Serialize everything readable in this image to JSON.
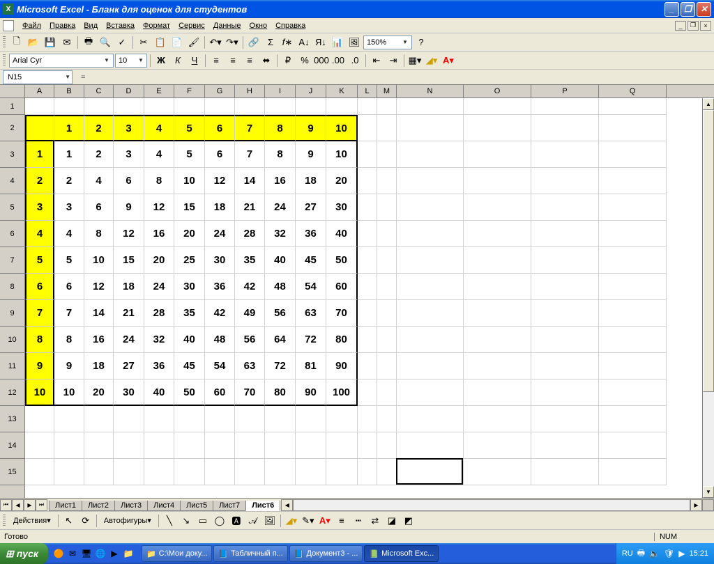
{
  "titlebar": {
    "app": "Microsoft Excel",
    "doc": "Бланк для оценок для студентов"
  },
  "menu": {
    "file": "Файл",
    "edit": "Правка",
    "view": "Вид",
    "insert": "Вставка",
    "format": "Формат",
    "tools": "Сервис",
    "data": "Данные",
    "window": "Окно",
    "help": "Справка"
  },
  "toolbar": {
    "zoom": "150%"
  },
  "format_bar": {
    "font": "Arial Cyr",
    "size": "10",
    "bold": "Ж",
    "italic": "К",
    "underline": "Ч"
  },
  "formula": {
    "namebox": "N15",
    "value": ""
  },
  "columns": [
    "A",
    "B",
    "C",
    "D",
    "E",
    "F",
    "G",
    "H",
    "I",
    "J",
    "K",
    "L",
    "M",
    "N",
    "O",
    "P",
    "Q"
  ],
  "col_widths": [
    "cw-A",
    "cw-B",
    "cw-C",
    "cw-D",
    "cw-E",
    "cw-F",
    "cw-G",
    "cw-H",
    "cw-I",
    "cw-J",
    "cw-K",
    "cw-L",
    "cw-M",
    "cw-N",
    "cw-O",
    "cw-P",
    "cw-Q"
  ],
  "rows": [
    "1",
    "2",
    "3",
    "4",
    "5",
    "6",
    "7",
    "8",
    "9",
    "10",
    "11",
    "12",
    "13",
    "14",
    "15"
  ],
  "table": {
    "header_row": [
      "",
      "1",
      "2",
      "3",
      "4",
      "5",
      "6",
      "7",
      "8",
      "9",
      "10"
    ],
    "body": [
      [
        "1",
        "1",
        "2",
        "3",
        "4",
        "5",
        "6",
        "7",
        "8",
        "9",
        "10"
      ],
      [
        "2",
        "2",
        "4",
        "6",
        "8",
        "10",
        "12",
        "14",
        "16",
        "18",
        "20"
      ],
      [
        "3",
        "3",
        "6",
        "9",
        "12",
        "15",
        "18",
        "21",
        "24",
        "27",
        "30"
      ],
      [
        "4",
        "4",
        "8",
        "12",
        "16",
        "20",
        "24",
        "28",
        "32",
        "36",
        "40"
      ],
      [
        "5",
        "5",
        "10",
        "15",
        "20",
        "25",
        "30",
        "35",
        "40",
        "45",
        "50"
      ],
      [
        "6",
        "6",
        "12",
        "18",
        "24",
        "30",
        "36",
        "42",
        "48",
        "54",
        "60"
      ],
      [
        "7",
        "7",
        "14",
        "21",
        "28",
        "35",
        "42",
        "49",
        "56",
        "63",
        "70"
      ],
      [
        "8",
        "8",
        "16",
        "24",
        "32",
        "40",
        "48",
        "56",
        "64",
        "72",
        "80"
      ],
      [
        "9",
        "9",
        "18",
        "27",
        "36",
        "45",
        "54",
        "63",
        "72",
        "81",
        "90"
      ],
      [
        "10",
        "10",
        "20",
        "30",
        "40",
        "50",
        "60",
        "70",
        "80",
        "90",
        "100"
      ]
    ]
  },
  "selection": {
    "cell": "N15"
  },
  "sheets": {
    "tabs": [
      "Лист1",
      "Лист2",
      "Лист3",
      "Лист4",
      "Лист5",
      "Лист7",
      "Лист6"
    ],
    "active": 6
  },
  "drawbar": {
    "actions": "Действия",
    "autoshapes": "Автофигуры"
  },
  "status": {
    "ready": "Готово",
    "num": "NUM"
  },
  "taskbar": {
    "start": "пуск",
    "tasks": [
      {
        "icon": "📁",
        "label": "C:\\Мои доку..."
      },
      {
        "icon": "📘",
        "label": "Табличный п..."
      },
      {
        "icon": "📘",
        "label": "Документ3 - ..."
      },
      {
        "icon": "📗",
        "label": "Microsoft Exc..."
      }
    ],
    "active_task": 3,
    "lang": "RU",
    "time": "15:21"
  }
}
